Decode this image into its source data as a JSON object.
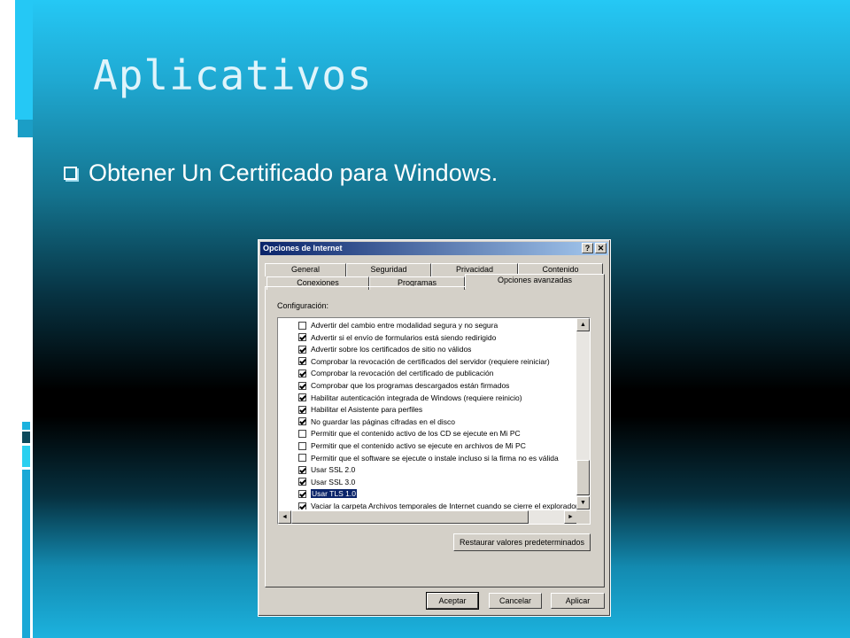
{
  "slide": {
    "title": "Aplicativos",
    "bullet": "Obtener Un Certificado para Windows."
  },
  "dialog": {
    "title": "Opciones de Internet",
    "help_glyph": "?",
    "close_glyph": "✕",
    "tabs_row1": [
      "General",
      "Seguridad",
      "Privacidad",
      "Contenido"
    ],
    "tabs_row2": [
      "Conexiones",
      "Programas",
      "Opciones avanzadas"
    ],
    "active_tab": "Opciones avanzadas",
    "config_label": "Configuración:",
    "items": [
      {
        "label": "Advertir del cambio entre modalidad segura y no segura",
        "checked": false
      },
      {
        "label": "Advertir si el envío de formularios está siendo redirigido",
        "checked": true
      },
      {
        "label": "Advertir sobre los certificados de sitio no válidos",
        "checked": true
      },
      {
        "label": "Comprobar la revocación de certificados del servidor (requiere reiniciar)",
        "checked": true
      },
      {
        "label": "Comprobar la revocación del certificado de publicación",
        "checked": true
      },
      {
        "label": "Comprobar que los programas descargados están firmados",
        "checked": true
      },
      {
        "label": "Habilitar autenticación integrada de Windows (requiere reinicio)",
        "checked": true
      },
      {
        "label": "Habilitar el Asistente para perfiles",
        "checked": true
      },
      {
        "label": "No guardar las páginas cifradas en el disco",
        "checked": true
      },
      {
        "label": "Permitir que el contenido activo de los CD se ejecute en Mi PC",
        "checked": false
      },
      {
        "label": "Permitir que el contenido activo se ejecute en archivos de Mi PC",
        "checked": false
      },
      {
        "label": "Permitir que el software se ejecute o instale incluso si la firma no es válida",
        "checked": false
      },
      {
        "label": "Usar SSL 2.0",
        "checked": true
      },
      {
        "label": "Usar SSL 3.0",
        "checked": true
      },
      {
        "label": "Usar TLS 1.0",
        "checked": true,
        "selected": true
      },
      {
        "label": "Vaciar la carpeta Archivos temporales de Internet cuando se cierre el explorador",
        "checked": true
      }
    ],
    "scroll": {
      "up": "▲",
      "down": "▼",
      "left": "◄",
      "right": "►"
    },
    "restore_button": "Restaurar valores predeterminados",
    "ok_button": "Aceptar",
    "cancel_button": "Cancelar",
    "apply_button": "Aplicar"
  },
  "colors": {
    "titlebar_start": "#0a246a",
    "titlebar_end": "#a6caf0",
    "dialog_face": "#d4d0c8",
    "slide_accent": "#25c8f5"
  }
}
